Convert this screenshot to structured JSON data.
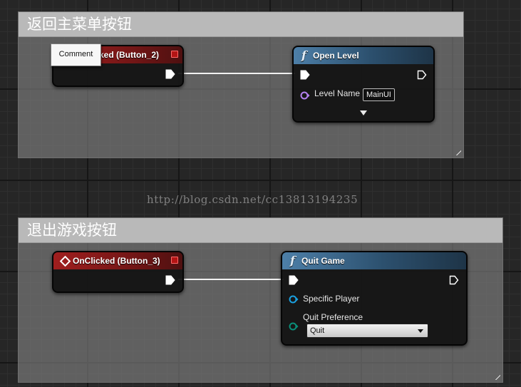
{
  "colors": {
    "event_header": "#a01e1e",
    "function_header": "#2c506e",
    "exec_pin": "#ffffff",
    "object_pin": "#b582f0",
    "player_pin": "#1aa0e0",
    "enum_pin": "#0a8f7a"
  },
  "comment_top": {
    "title": "返回主菜单按钮",
    "event_node": {
      "title": "OnClicked (Button_2)",
      "title_visible": "ked (Button_2)",
      "icon": "event-diamond-icon"
    },
    "function_node": {
      "icon": "function-f-icon",
      "title": "Open Level",
      "pins": [
        {
          "label": "Level Name",
          "value": "MainUI",
          "icon": "object-pin-icon"
        }
      ],
      "advanced_icon": "expand-advanced-icon"
    }
  },
  "tooltip": {
    "text": "Comment"
  },
  "watermark": {
    "text": "http://blog.csdn.net/cc13813194235"
  },
  "comment_bottom": {
    "title": "退出游戏按钮",
    "event_node": {
      "title": "OnClicked (Button_3)",
      "icon": "event-diamond-icon"
    },
    "function_node": {
      "icon": "function-f-icon",
      "title": "Quit Game",
      "pins": [
        {
          "label": "Specific Player",
          "icon": "player-pin-icon"
        },
        {
          "label": "Quit Preference",
          "value": "Quit",
          "icon": "enum-pin-icon"
        }
      ]
    }
  }
}
